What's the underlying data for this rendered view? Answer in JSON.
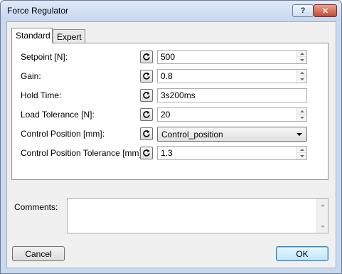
{
  "window": {
    "title": "Force Regulator",
    "help_glyph": "?",
    "close_glyph": "✕"
  },
  "tabs": [
    {
      "label": "Standard",
      "active": true
    },
    {
      "label": "Expert",
      "active": false
    }
  ],
  "fields": [
    {
      "label": "Setpoint [N]:",
      "value": "500",
      "type": "spinner"
    },
    {
      "label": "Gain:",
      "value": "0.8",
      "type": "spinner"
    },
    {
      "label": "Hold Time:",
      "value": "3s200ms",
      "type": "text"
    },
    {
      "label": "Load Tolerance [N]:",
      "value": "20",
      "type": "spinner"
    },
    {
      "label": "Control Position [mm]:",
      "value": "Control_position",
      "type": "combo"
    },
    {
      "label": "Control Position Tolerance [mm]:",
      "value": "1.3",
      "type": "spinner"
    }
  ],
  "comments": {
    "label": "Comments:",
    "value": ""
  },
  "buttons": {
    "cancel": "Cancel",
    "ok": "OK"
  },
  "icons": {
    "field_action": "refresh-icon"
  },
  "colors": {
    "title_bar": "#c6d7ef",
    "close_button": "#c44a32",
    "ok_default_border": "#3c7fb1"
  }
}
